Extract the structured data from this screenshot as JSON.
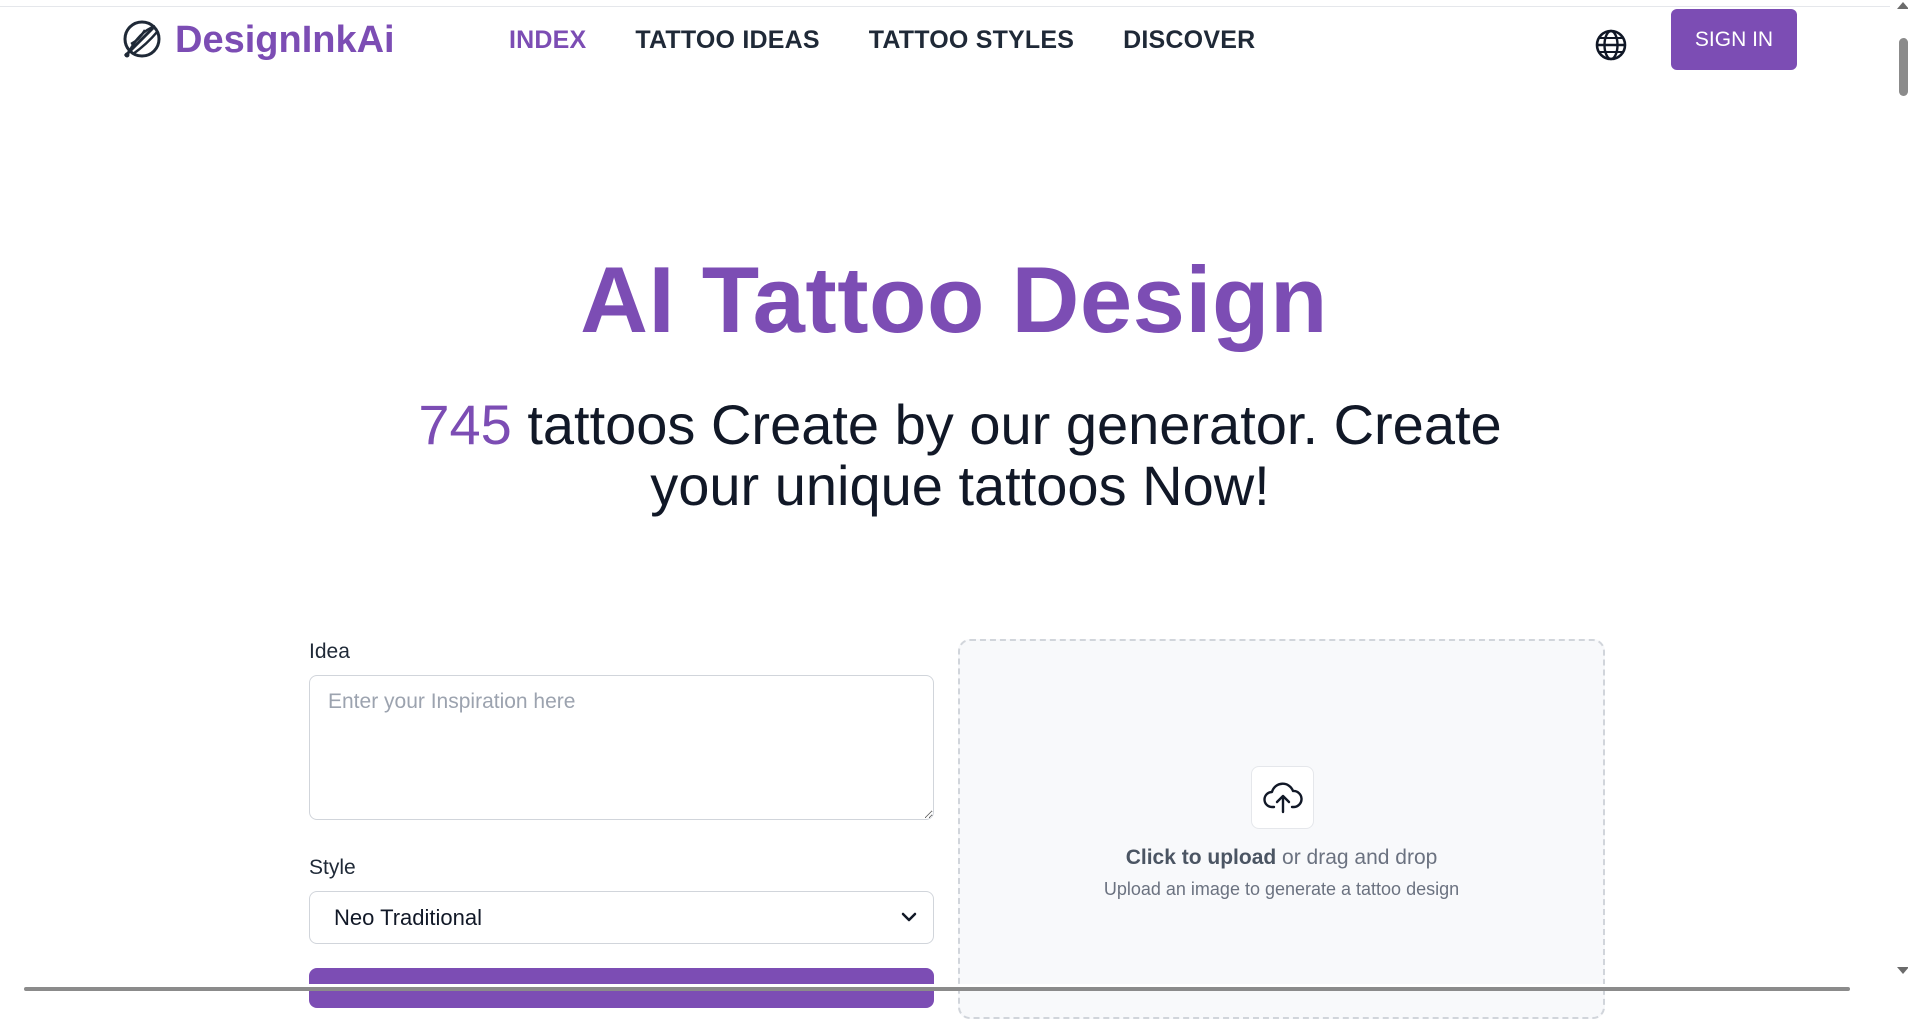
{
  "brand": {
    "name": "DesignInkAi",
    "logo_icon": "feather-swirl-icon"
  },
  "nav": {
    "items": [
      {
        "label": "INDEX",
        "active": true
      },
      {
        "label": "TATTOO IDEAS",
        "active": false
      },
      {
        "label": "TATTOO STYLES",
        "active": false
      },
      {
        "label": "DISCOVER",
        "active": false
      }
    ]
  },
  "header": {
    "language_icon": "globe-icon",
    "signin_label": "SIGN IN"
  },
  "hero": {
    "title": "AI Tattoo Design",
    "count": "745",
    "subtitle_rest": " tattoos Create by our generator. Create your unique tattoos Now!"
  },
  "form": {
    "idea_label": "Idea",
    "idea_placeholder": "Enter your Inspiration here",
    "idea_value": "",
    "style_label": "Style",
    "style_selected": "Neo Traditional"
  },
  "upload": {
    "icon": "cloud-upload-icon",
    "click_text": "Click to upload",
    "drag_text": " or drag and drop",
    "hint": "Upload an image to generate a tattoo design"
  },
  "colors": {
    "accent": "#7c4db4",
    "text": "#111827",
    "muted": "#6b7280",
    "border": "#d1d5db"
  }
}
